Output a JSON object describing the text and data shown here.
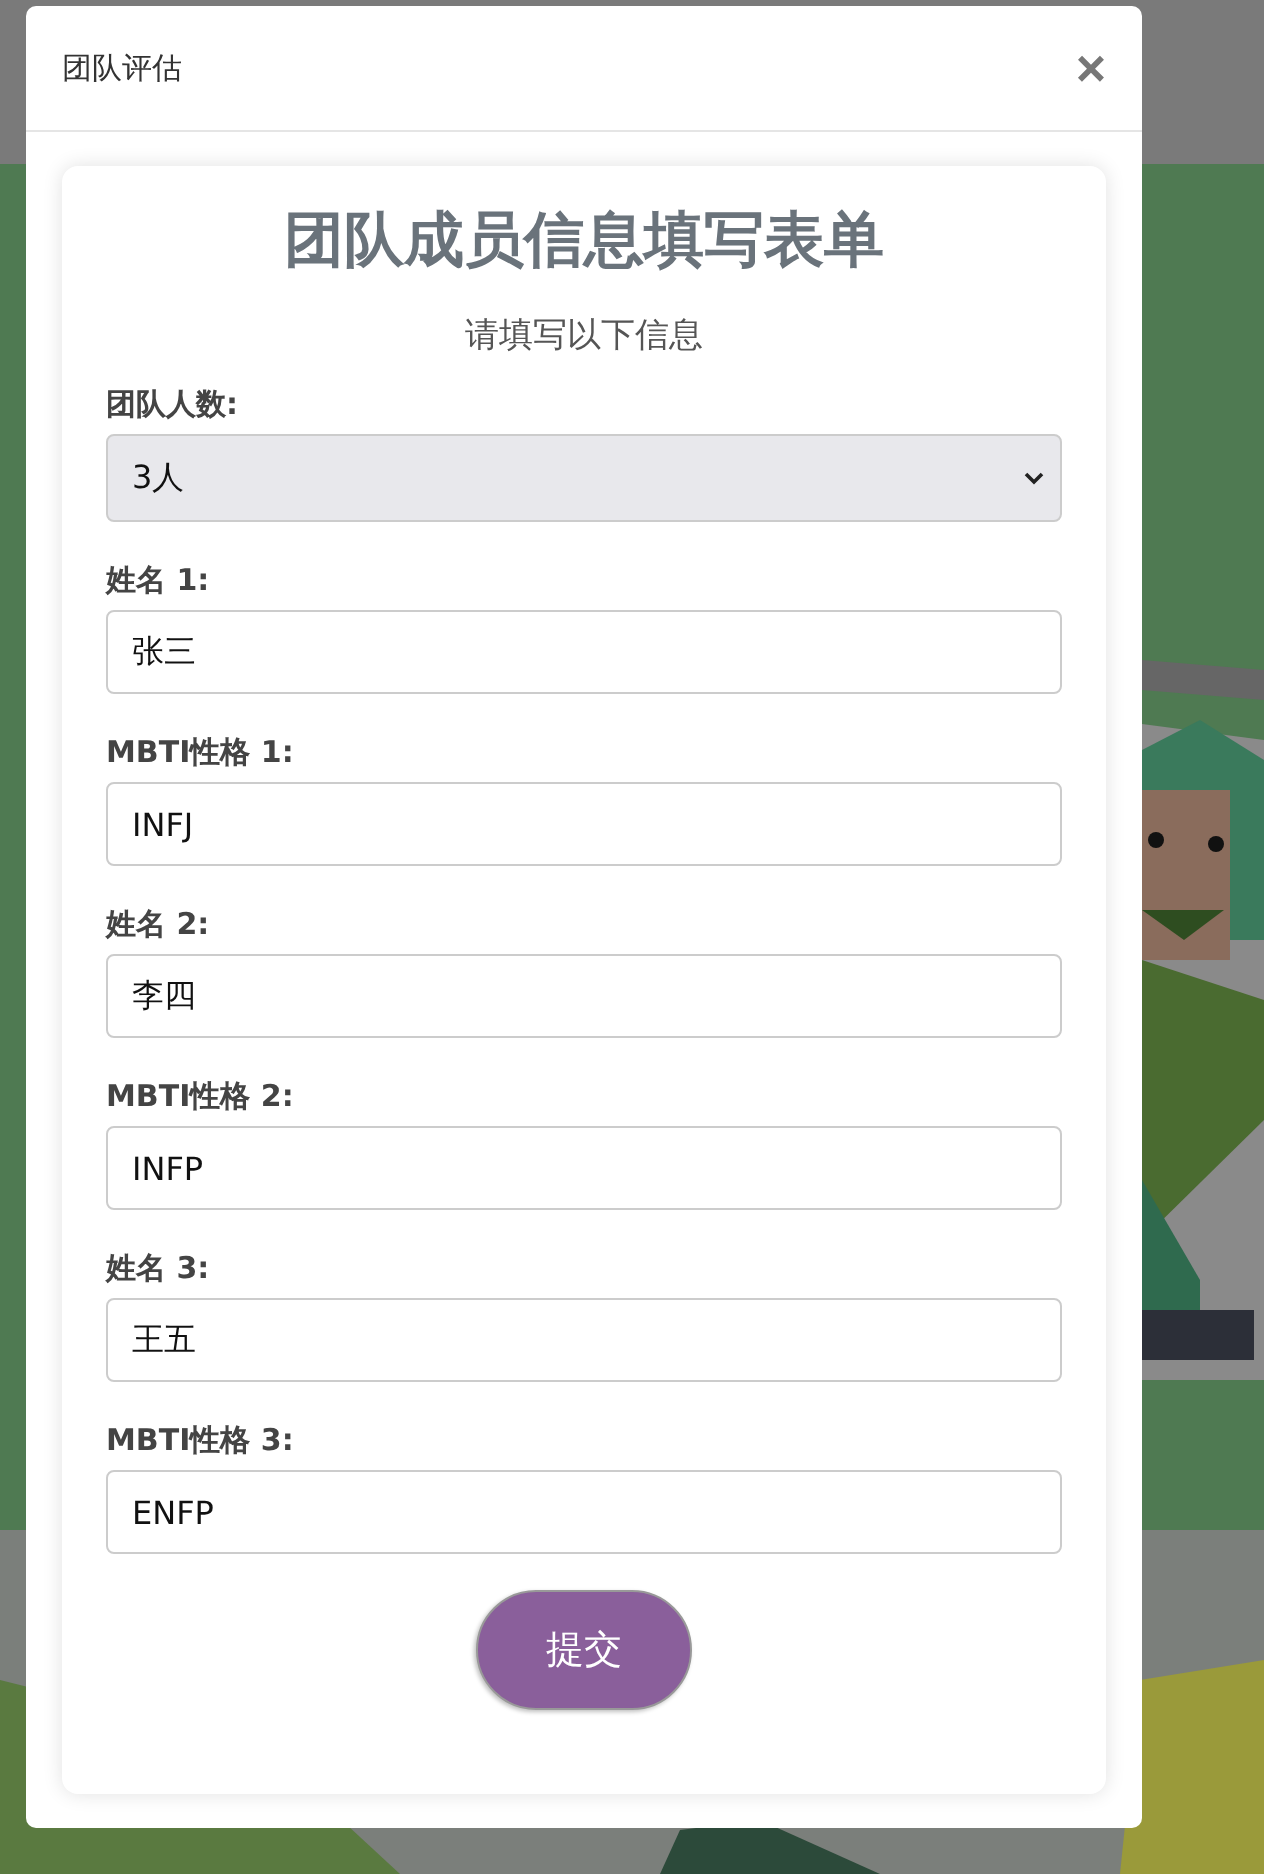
{
  "modal": {
    "title": "团队评估",
    "close": "×"
  },
  "form": {
    "title": "团队成员信息填写表单",
    "subtitle": "请填写以下信息",
    "team_size": {
      "label": "团队人数:",
      "value": "3人"
    },
    "fields": [
      {
        "label": "姓名 1:",
        "value": "张三"
      },
      {
        "label": "MBTI性格 1:",
        "value": "INFJ"
      },
      {
        "label": "姓名 2:",
        "value": "李四"
      },
      {
        "label": "MBTI性格 2:",
        "value": "INFP"
      },
      {
        "label": "姓名 3:",
        "value": "王五"
      },
      {
        "label": "MBTI性格 3:",
        "value": "ENFP"
      }
    ],
    "submit": "提交"
  }
}
